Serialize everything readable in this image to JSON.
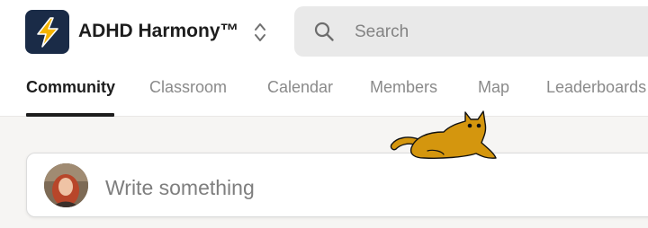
{
  "header": {
    "app_name": "ADHD Harmony™",
    "logo_icon": "lightning-bolt-icon",
    "switcher_icon": "chevron-up-down-icon",
    "search": {
      "icon": "search-icon",
      "placeholder": "Search"
    }
  },
  "nav": {
    "tabs": [
      {
        "label": "Community",
        "active": true
      },
      {
        "label": "Classroom",
        "active": false
      },
      {
        "label": "Calendar",
        "active": false
      },
      {
        "label": "Members",
        "active": false
      },
      {
        "label": "Map",
        "active": false
      },
      {
        "label": "Leaderboards",
        "active": false
      }
    ]
  },
  "composer": {
    "placeholder": "Write something",
    "avatar": "user-avatar"
  },
  "decoration": {
    "sticker": "cat-sticker"
  },
  "colors": {
    "logo_bg": "#1a2b47",
    "logo_bolt": "#f5b400",
    "active_tab": "#1d1d1d",
    "inactive_tab": "#8a8a8a",
    "page_bg": "#f6f5f3",
    "cat": "#d4960e"
  }
}
